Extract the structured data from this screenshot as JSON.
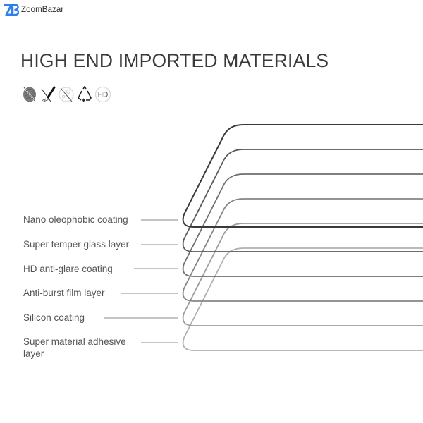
{
  "brand": {
    "name": "ZoomBazar",
    "logo_icon": "zoombazar-zb-logo-icon",
    "color": "#2f80ed"
  },
  "heading": "HIGH END IMPORTED MATERIALS",
  "feature_icons": [
    {
      "name": "anti-fingerprint-icon",
      "label": "Anti-fingerprint"
    },
    {
      "name": "scratch-resistant-icon",
      "label": "Scratch resistant"
    },
    {
      "name": "anti-bubble-icon",
      "label": "Anti-bubble"
    },
    {
      "name": "recyclable-icon",
      "label": "Recyclable"
    },
    {
      "name": "hd-icon",
      "label": "HD"
    }
  ],
  "hd_badge_text": "HD",
  "layers": [
    {
      "label": "Nano oleophobic coating",
      "shade": "#3a3a3a"
    },
    {
      "label": "Super temper glass layer",
      "shade": "#5a5a5a"
    },
    {
      "label": "HD anti-glare coating",
      "shade": "#6e6e6e"
    },
    {
      "label": "Anti-burst film layer",
      "shade": "#858585"
    },
    {
      "label": "Silicon coating",
      "shade": "#9c9c9c"
    },
    {
      "label": "Super material adhesive\nlayer",
      "label_line1": "Super material adhesive",
      "label_line2": "layer",
      "shade": "#b0b0b0"
    }
  ],
  "leader_line_color": "#8a8a8a"
}
